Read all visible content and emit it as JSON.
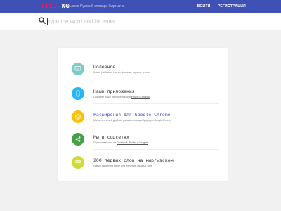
{
  "header": {
    "logo_part1": "TILI",
    "logo_part2": ".",
    "logo_part3": "KG",
    "subtitle": "Кыргызско-Русский словарь Кыргызча",
    "login_label": "ВОЙТИ",
    "register_label": "РЕГИСТРАЦИЯ",
    "colors": {
      "bar": "#3f51b5",
      "logo_accent": "#e91e63"
    }
  },
  "search": {
    "placeholder": "type the word and hit enter",
    "value": ""
  },
  "features": [
    {
      "icon": "chat-icon",
      "color": "#80cbc4",
      "title": "Полезное",
      "description": "Книги, учебники, статьи, фильмы, музыка, клипы"
    },
    {
      "icon": "smartphone-icon",
      "color": "#29b6f6",
      "title": "Наши приложения",
      "description_pre": "Скачайте наше приложение для ",
      "description_link": "iPhone и Android"
    },
    {
      "icon": "chrome-icon",
      "color": "#ffc107",
      "title": "Расширения для Google Chrome",
      "description": "Мы выпустили 2 удобных расширения для браузера Google Chrome"
    },
    {
      "icon": "share-icon",
      "color": "#43a047",
      "title": "Мы в соцсетях",
      "description_pre": "Подписывайтесь на ",
      "description_link": "Facebook, Twitter и Google+"
    },
    {
      "icon": "badge-200-icon",
      "color": "#cddc39",
      "badge_text": "200",
      "title": "200 первых слов на кыргызском",
      "description": "Новый раздел на сайте для изучения базовых слов"
    }
  ]
}
